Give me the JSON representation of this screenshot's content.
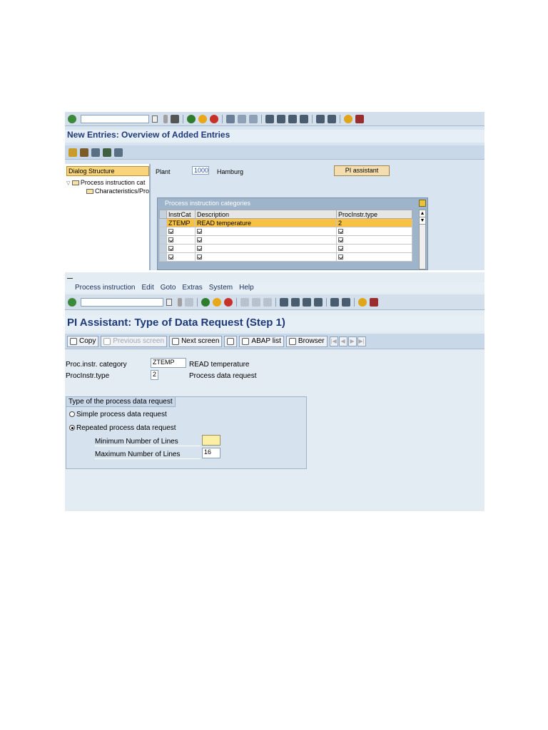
{
  "screen1": {
    "title": "New Entries: Overview of Added Entries",
    "dialog_structure": {
      "header": "Dialog Structure",
      "items": [
        "Process instruction cat",
        "Characteristics/Pro"
      ]
    },
    "plant": {
      "label": "Plant",
      "value": "1000",
      "name": "Hamburg"
    },
    "pi_assistant_button": "PI assistant",
    "table": {
      "title": "Process instruction categories",
      "columns": [
        "InstrCat",
        "Description",
        "ProcInstr.type"
      ],
      "selected_row": {
        "instrcat": "ZTEMP",
        "description": "READ temperature",
        "type": "2"
      },
      "empty_rows": 4
    }
  },
  "screen2": {
    "menu": [
      "Process instruction",
      "Edit",
      "Goto",
      "Extras",
      "System",
      "Help"
    ],
    "title": "PI Assistant: Type of Data Request (Step 1)",
    "buttons": {
      "copy": "Copy",
      "previous": "Previous screen",
      "next": "Next screen",
      "abap": "ABAP list",
      "browser": "Browser"
    },
    "fields": {
      "category_label": "Proc.instr. category",
      "category_value": "ZTEMP",
      "category_desc": "READ temperature",
      "type_label": "ProcInstr.type",
      "type_value": "2",
      "type_desc": "Process data request"
    },
    "group": {
      "title": "Type of the process data request",
      "option_simple": "Simple process data request",
      "option_repeated": "Repeated process data request",
      "min_label": "Minimum Number of Lines",
      "min_value": "",
      "max_label": "Maximum Number of Lines",
      "max_value": "16"
    }
  }
}
